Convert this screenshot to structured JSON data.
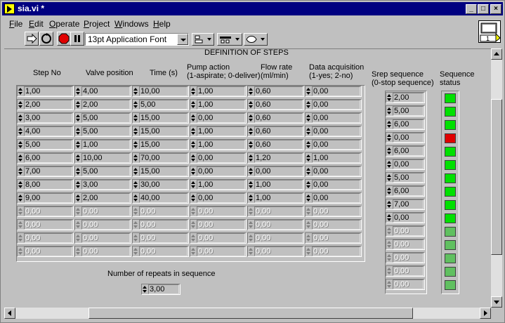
{
  "window": {
    "title": "sia.vi *"
  },
  "menu": [
    "File",
    "Edit",
    "Operate",
    "Project",
    "Windows",
    "Help"
  ],
  "menu_underline": [
    "F",
    "E",
    "O",
    "P",
    "W",
    "H"
  ],
  "toolbar": {
    "font": "13pt Application Font",
    "vi_icon_label": "1"
  },
  "panel_title": "DEFINITION OF STEPS",
  "columns": [
    {
      "l1": "Step No",
      "l2": ""
    },
    {
      "l1": "Valve position",
      "l2": ""
    },
    {
      "l1": "Time (s)",
      "l2": ""
    },
    {
      "l1": "Pump action",
      "l2": "(1-aspirate; 0-deliver)"
    },
    {
      "l1": "Flow rate",
      "l2": "(ml/min)"
    },
    {
      "l1": "Data acquisition",
      "l2": "(1-yes; 2-no)"
    }
  ],
  "rows": [
    [
      "1,00",
      "4,00",
      "10,00",
      "1,00",
      "0,60",
      "0,00"
    ],
    [
      "2,00",
      "2,00",
      "5,00",
      "1,00",
      "0,60",
      "0,00"
    ],
    [
      "3,00",
      "5,00",
      "15,00",
      "0,00",
      "0,60",
      "0,00"
    ],
    [
      "4,00",
      "5,00",
      "15,00",
      "1,00",
      "0,60",
      "0,00"
    ],
    [
      "5,00",
      "1,00",
      "15,00",
      "1,00",
      "0,60",
      "0,00"
    ],
    [
      "6,00",
      "10,00",
      "70,00",
      "0,00",
      "1,20",
      "1,00"
    ],
    [
      "7,00",
      "5,00",
      "15,00",
      "0,00",
      "0,00",
      "0,00"
    ],
    [
      "8,00",
      "3,00",
      "30,00",
      "1,00",
      "1,00",
      "0,00"
    ],
    [
      "9,00",
      "2,00",
      "40,00",
      "0,00",
      "1,00",
      "0,00"
    ],
    [
      "0,00",
      "0,00",
      "0,00",
      "0,00",
      "0,00",
      "0,00"
    ],
    [
      "0,00",
      "0,00",
      "0,00",
      "0,00",
      "0,00",
      "0,00"
    ],
    [
      "0,00",
      "0,00",
      "0,00",
      "0,00",
      "0,00",
      "0,00"
    ],
    [
      "0,00",
      "0,00",
      "0,00",
      "0,00",
      "0,00",
      "0,00"
    ]
  ],
  "active_rows": 9,
  "sequence": {
    "label1": "Srep sequence",
    "label2": "(0-stop sequence)",
    "values": [
      "2,00",
      "5,00",
      "6,00",
      "0,00",
      "6,00",
      "0,00",
      "5,00",
      "6,00",
      "7,00",
      "0,00",
      "0,00",
      "0,00",
      "0,00",
      "0,00",
      "0,00"
    ],
    "active": 10
  },
  "status": {
    "label1": "Sequence",
    "label2": "status",
    "leds": [
      "on",
      "on",
      "on",
      "red",
      "on",
      "on",
      "on",
      "on",
      "on",
      "on",
      "dim",
      "dim",
      "dim",
      "dim",
      "dim"
    ],
    "colors": {
      "on": "#00e000",
      "red": "#e00000",
      "dim": "#60c060"
    }
  },
  "repeats": {
    "label": "Number of repeats in sequence",
    "value": "3,00"
  }
}
